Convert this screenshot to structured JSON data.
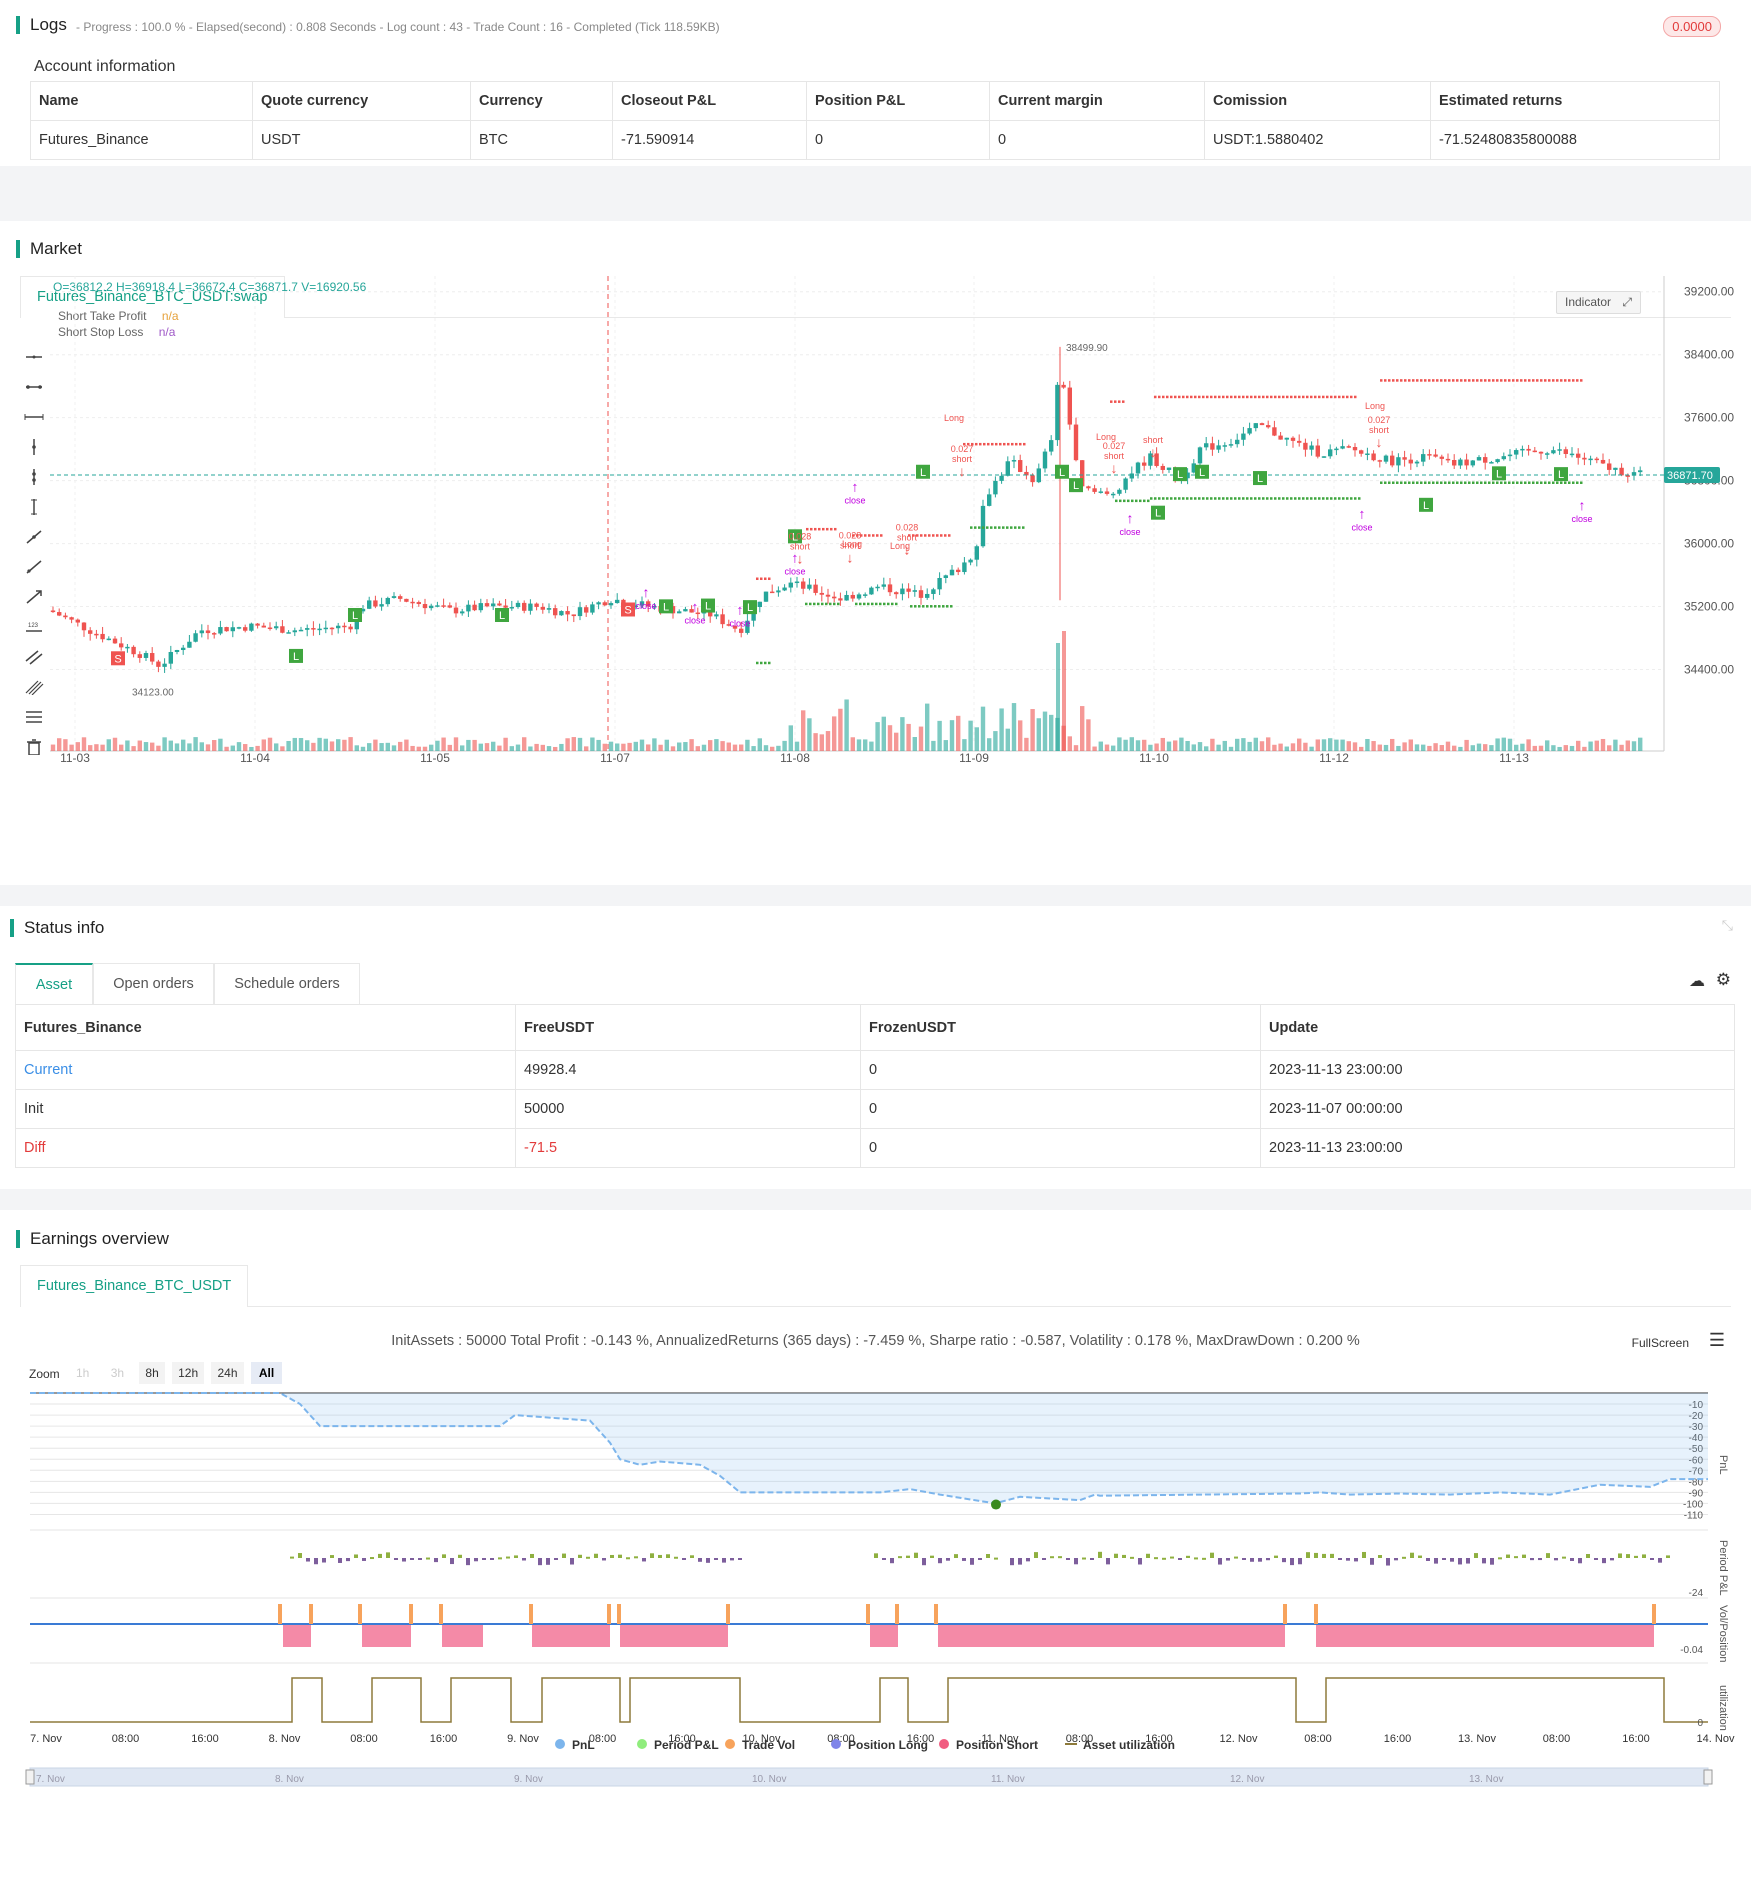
{
  "logs": {
    "title": "Logs",
    "summary": "- Progress : 100.0 % - Elapsed(second) : 0.808  Seconds - Log count : 43 - Trade Count : 16 - Completed (Tick 118.59KB)",
    "badge": "0.0000"
  },
  "account": {
    "title": "Account information",
    "headers": [
      "Name",
      "Quote currency",
      "Currency",
      "Closeout P&L",
      "Position P&L",
      "Current margin",
      "Comission",
      "Estimated returns"
    ],
    "row": [
      "Futures_Binance",
      "USDT",
      "BTC",
      "-71.590914",
      "0",
      "0",
      "USDT:1.5880402",
      "-71.52480835800088"
    ]
  },
  "market": {
    "title": "Market",
    "tab": "Futures_Binance_BTC_USDT:swap",
    "ohlc": "O=36812.2 H=36918.4 L=36672.4 C=36871.7 V=16920.56",
    "legend": [
      {
        "label": "Short Take Profit",
        "value": "n/a",
        "color": "#e6a23c"
      },
      {
        "label": "Short Stop Loss",
        "value": "n/a",
        "color": "#a05ac8"
      }
    ],
    "indicator_btn": "Indicator",
    "price_ticks": [
      "39200.00",
      "38400.00",
      "37600.00",
      "36800.00",
      "36000.00",
      "35200.00",
      "34400.00"
    ],
    "current_price": "36871.70",
    "high_label": "38499.90",
    "low_label": "34123.00",
    "date_ticks": [
      "11-03",
      "11-04",
      "11-05",
      "11-07",
      "11-08",
      "11-09",
      "11-10",
      "11-12",
      "11-13"
    ],
    "annotations": {
      "close": "close",
      "short": "short",
      "long": "Long",
      "qty1": "0.027",
      "qty2": "0.028",
      "s": "S",
      "l": "L"
    },
    "colors": {
      "up": "#26a69a",
      "down": "#ef5350",
      "profit": "#3fa63f"
    }
  },
  "status": {
    "title": "Status info",
    "tabs": [
      "Asset",
      "Open orders",
      "Schedule orders"
    ],
    "headers": [
      "Futures_Binance",
      "FreeUSDT",
      "FrozenUSDT",
      "Update"
    ],
    "rows": [
      [
        "Current",
        "49928.4",
        "0",
        "2023-11-13 23:00:00"
      ],
      [
        "Init",
        "50000",
        "0",
        "2023-11-07 00:00:00"
      ],
      [
        "Diff",
        "-71.5",
        "0",
        "2023-11-13 23:00:00"
      ]
    ]
  },
  "earnings": {
    "title": "Earnings overview",
    "tab": "Futures_Binance_BTC_USDT",
    "summary": "InitAssets : 50000 Total Profit : -0.143 %, AnnualizedReturns (365 days) : -7.459 %, Sharpe ratio : -0.587, Volatility : 0.178 %, MaxDrawDown : 0.200 %",
    "fullscreen": "FullScreen",
    "zoom_label": "Zoom",
    "zoom": [
      "1h",
      "3h",
      "8h",
      "12h",
      "24h",
      "All"
    ],
    "pnl_ticks": [
      "-10",
      "-20",
      "-30",
      "-40",
      "-50",
      "-60",
      "-70",
      "-80",
      "-90",
      "-100",
      "-110"
    ],
    "period_tick": "-24",
    "vol_tick": "-0.04",
    "util_tick": "0",
    "axis_names": [
      "PnL",
      "Period P&L",
      "Vol/Position",
      "utilization"
    ],
    "time_ticks": [
      "7. Nov",
      "08:00",
      "16:00",
      "8. Nov",
      "08:00",
      "16:00",
      "9. Nov",
      "08:00",
      "16:00",
      "10. Nov",
      "08:00",
      "16:00",
      "11. Nov",
      "08:00",
      "16:00",
      "12. Nov",
      "08:00",
      "16:00",
      "13. Nov",
      "08:00",
      "16:00",
      "14. Nov"
    ],
    "nav_ticks": [
      "7. Nov",
      "8. Nov",
      "9. Nov",
      "10. Nov",
      "11. Nov",
      "12. Nov",
      "13. Nov"
    ],
    "legend": [
      {
        "label": "PnL",
        "color": "#7cb5ec"
      },
      {
        "label": "Period P&L",
        "color": "#90ed7d"
      },
      {
        "label": "Trade Vol",
        "color": "#f7a35c"
      },
      {
        "label": "Position Long",
        "color": "#8085e9"
      },
      {
        "label": "Position Short",
        "color": "#f15c80"
      },
      {
        "label": "Asset utilization",
        "color": "#8d7a3b"
      }
    ]
  }
}
